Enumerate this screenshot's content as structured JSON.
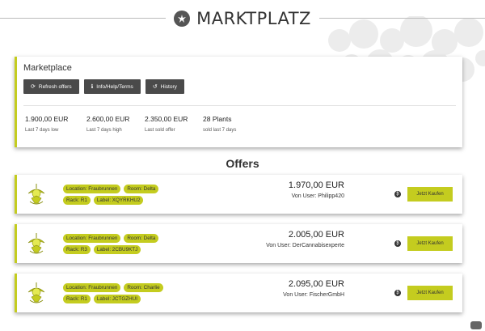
{
  "header": {
    "title": "MARKTPLATZ",
    "logo_icon": "leaf-logo-icon"
  },
  "marketplace": {
    "title": "Marketplace",
    "buttons": [
      {
        "label": "Refresh offers",
        "icon": "refresh-icon"
      },
      {
        "label": "Info/Help/Terms",
        "icon": "info-icon"
      },
      {
        "label": "History",
        "icon": "history-icon"
      }
    ],
    "stats": [
      {
        "value": "1.900,00 EUR",
        "label": "Last 7 days low"
      },
      {
        "value": "2.600,00 EUR",
        "label": "Last 7 days high"
      },
      {
        "value": "2.350,00 EUR",
        "label": "Last sold offer"
      },
      {
        "value": "28 Plants",
        "label": "sold last 7 days"
      }
    ]
  },
  "offers_title": "Offers",
  "offers": [
    {
      "location": "Location: Fraubrunnen",
      "room": "Room: Delta",
      "rack": "Rack: R1",
      "label": "Label: XQYRKHU2",
      "price": "1.970,00 EUR",
      "user": "Von User: Philipp420",
      "buy_label": "Jetzt Kaufen"
    },
    {
      "location": "Location: Fraubrunnen",
      "room": "Room: Delta",
      "rack": "Rack: R3",
      "label": "Label: 2CBU9KTJ",
      "price": "2.005,00 EUR",
      "user": "Von User: DerCannabisexperte",
      "buy_label": "Jetzt Kaufen"
    },
    {
      "location": "Location: Fraubrunnen",
      "room": "Room: Charlie",
      "rack": "Rack: R1",
      "label": "Label: JCTGZHUI",
      "price": "2.095,00 EUR",
      "user": "Von User: FischerGmbH",
      "buy_label": "Jetzt Kaufen"
    }
  ],
  "colors": {
    "accent": "#c4cc1f",
    "button_dark": "#4a4a4a"
  }
}
